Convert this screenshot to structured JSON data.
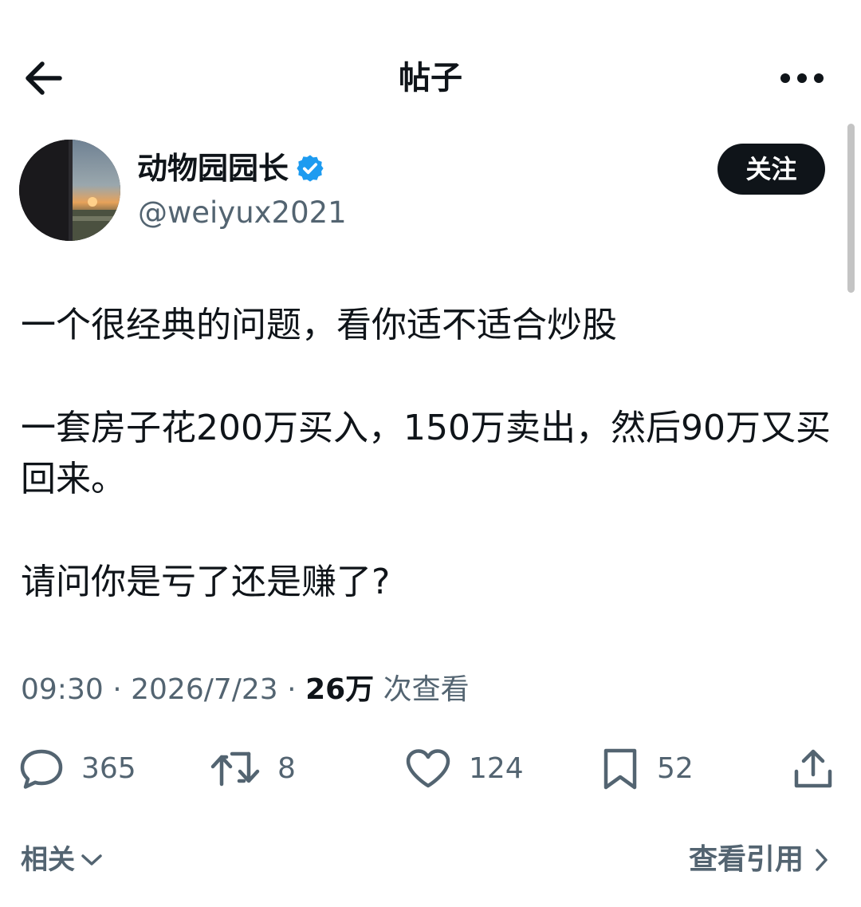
{
  "header": {
    "title": "帖子",
    "back_icon": "arrow-left-icon",
    "more_icon": "more-horizontal-icon"
  },
  "author": {
    "display_name": "动物园园长",
    "handle": "@weiyux2021",
    "verified_icon": "verified-badge-icon",
    "verified_color": "#1d9bf0",
    "follow_label": "关注"
  },
  "post": {
    "paragraphs": [
      "一个很经典的问题，看你适不适合炒股",
      "一套房子花200万买入，150万卖出，然后90万又买回来。",
      "请问你是亏了还是赚了?"
    ],
    "time": "09:30",
    "separator": "·",
    "date": "2026/7/23",
    "views_count": "26万",
    "views_label": "次查看"
  },
  "actions": {
    "replies": {
      "icon": "reply-icon",
      "count": "365"
    },
    "reposts": {
      "icon": "repost-icon",
      "count": "8"
    },
    "likes": {
      "icon": "heart-icon",
      "count": "124"
    },
    "bookmarks": {
      "icon": "bookmark-icon",
      "count": "52"
    },
    "share": {
      "icon": "share-icon"
    }
  },
  "footer": {
    "related_label": "相关",
    "quotes_label": "查看引用"
  },
  "colors": {
    "text_primary": "#0f1419",
    "text_secondary": "#536471",
    "accent": "#1d9bf0",
    "follow_button_bg": "#0f1419"
  }
}
